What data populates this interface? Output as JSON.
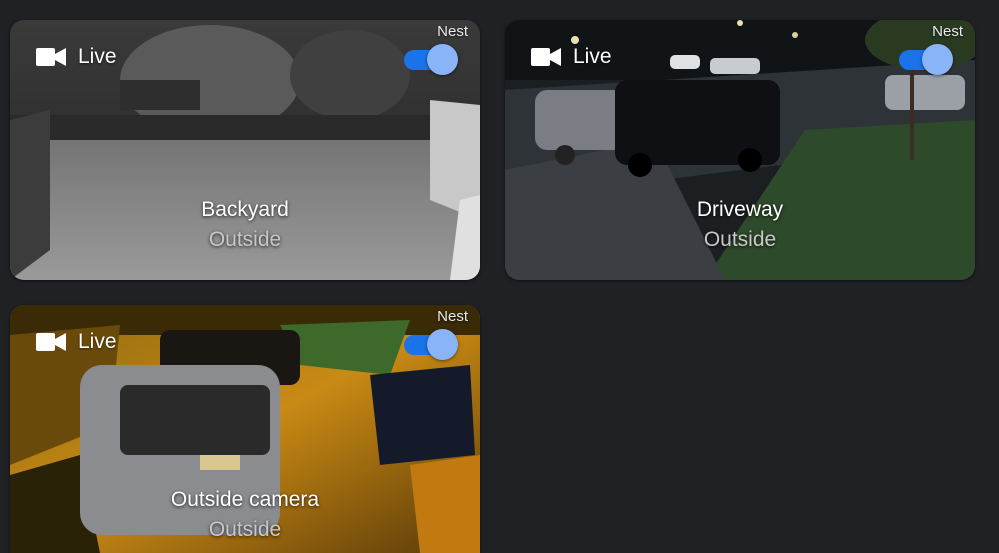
{
  "colors": {
    "background": "#202124",
    "toggle_track": "#1a73e8",
    "toggle_thumb": "#8ab4f8"
  },
  "cameras": [
    {
      "live_label": "Live",
      "live_icon": "videocam-icon",
      "badge": "Nest",
      "streaming_on": true,
      "name": "Backyard",
      "room": "Outside"
    },
    {
      "live_label": "Live",
      "live_icon": "videocam-icon",
      "badge": "Nest",
      "streaming_on": true,
      "name": "Driveway",
      "room": "Outside"
    },
    {
      "live_label": "Live",
      "live_icon": "videocam-icon",
      "badge": "Nest",
      "streaming_on": true,
      "name": "Outside camera",
      "room": "Outside"
    }
  ]
}
